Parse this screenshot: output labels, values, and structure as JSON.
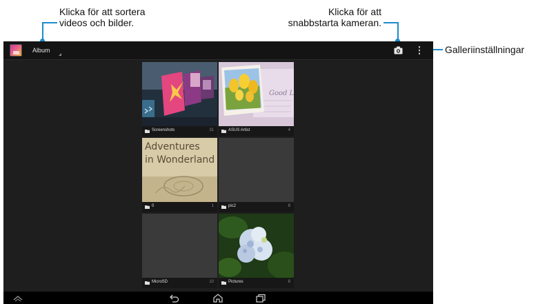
{
  "callouts": {
    "sort": {
      "line1": "Klicka för att sortera",
      "line2": "videos och bilder."
    },
    "camera": {
      "line1": "Klicka för att",
      "line2": "snabbstarta kameran."
    },
    "settings": {
      "text": "Galleriinställningar"
    }
  },
  "action_bar": {
    "title": "Album",
    "camera_icon": "camera-icon",
    "menu_icon": "overflow-menu-icon"
  },
  "albums": [
    {
      "name": "Screenshots",
      "count": "31"
    },
    {
      "name": "ASUS Artist",
      "count": "4"
    },
    {
      "name": "0",
      "count": "1"
    },
    {
      "name": "pic2",
      "count": "8"
    },
    {
      "name": "MicroSD",
      "count": "10"
    },
    {
      "name": "Pictures",
      "count": "8"
    }
  ],
  "thumbnails": {
    "asus_artist_card_text": "Good Lu",
    "book_cover_line1": "Adventures",
    "book_cover_line2": "in Wonderland"
  },
  "nav_bar": {
    "icons": [
      "nav-up-icon",
      "back-icon",
      "home-icon",
      "recent-apps-icon"
    ]
  },
  "colors": {
    "callout_accent": "#1b8ccc",
    "screen_background": "#1e1e1e",
    "action_bar_background": "#141414"
  }
}
